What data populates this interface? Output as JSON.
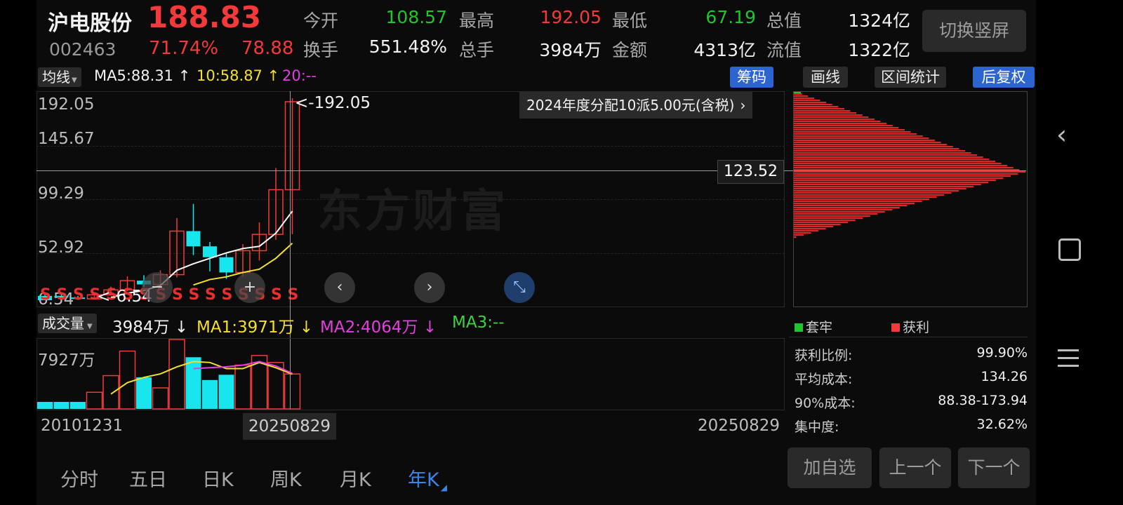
{
  "stock": {
    "name": "沪电股份",
    "price": "188.83",
    "code": "002463",
    "change_pct": "71.74%",
    "change_amt": "78.88"
  },
  "quote": [
    {
      "label": "今开",
      "value": "108.57"
    },
    {
      "label": "最高",
      "value": "192.05"
    },
    {
      "label": "最低",
      "value": "67.19"
    },
    {
      "label": "总值",
      "value": "1324亿"
    },
    {
      "label": "换手",
      "value": "551.48%"
    },
    {
      "label": "总手",
      "value": "3984万"
    },
    {
      "label": "金额",
      "value": "4313亿"
    },
    {
      "label": "流值",
      "value": "1322亿"
    }
  ],
  "switch_button": "切换竖屏",
  "ma_bar": {
    "selector": "均线",
    "ma5": "MA5:88.31",
    "ma10": "10:58.87",
    "ma20": "20:--",
    "arrow_up": "↑"
  },
  "tools": {
    "chips": "筹码",
    "draw": "画线",
    "range": "区间统计",
    "adjust": "后复权"
  },
  "price_chart": {
    "y_ticks": [
      "192.05",
      "145.67",
      "99.29",
      "52.92",
      "6.54"
    ],
    "high_marker": "<-192.05",
    "low_marker": "<-6.54",
    "crosshair_value": "123.52",
    "dividend_note": "2024年度分配10派5.00元(含税)",
    "watermark": "东方财富",
    "s_marker": "S"
  },
  "volume_bar": {
    "selector": "成交量",
    "current": "3984万",
    "ma1": "MA1:3971万",
    "ma2": "MA2:4064万",
    "ma3": "MA3:--",
    "arrow_down": "↓"
  },
  "volume_chart": {
    "y_tick": "7927万",
    "x_start": "20101231",
    "x_cursor": "20250829",
    "x_end": "20250829"
  },
  "chips_panel": {
    "legend_trapped": "套牢",
    "legend_profit": "获利",
    "stats": [
      {
        "label": "获利比例:",
        "value": "99.90%"
      },
      {
        "label": "平均成本:",
        "value": "134.26"
      },
      {
        "label": "90%成本:",
        "value": "88.38-173.94"
      },
      {
        "label": "集中度:",
        "value": "32.62%"
      }
    ]
  },
  "periods": [
    "分时",
    "五日",
    "日K",
    "周K",
    "月K",
    "年K"
  ],
  "actions": {
    "add_watch": "加自选",
    "prev": "上一个",
    "next": "下一个"
  },
  "colors": {
    "up": "#f23a3a",
    "down": "#22c42c",
    "cyan": "#17e6ee",
    "accent": "#2c65d0"
  },
  "chart_data": {
    "type": "bar",
    "candles": [
      {
        "o": 6.54,
        "c": 10.5,
        "h": 11.5,
        "l": 6.54,
        "up": false
      },
      {
        "o": 10.5,
        "c": 9.0,
        "h": 12.0,
        "l": 7.5,
        "up": false
      },
      {
        "o": 9.0,
        "c": 7.8,
        "h": 10.5,
        "l": 6.8,
        "up": false
      },
      {
        "o": 7.8,
        "c": 11.5,
        "h": 13.5,
        "l": 7.2,
        "up": true
      },
      {
        "o": 11.5,
        "c": 16.0,
        "h": 19.0,
        "l": 10.8,
        "up": true
      },
      {
        "o": 16.0,
        "c": 24.5,
        "h": 28.5,
        "l": 14.8,
        "up": true
      },
      {
        "o": 24.5,
        "c": 21.0,
        "h": 29.5,
        "l": 18.8,
        "up": false
      },
      {
        "o": 21.0,
        "c": 30.0,
        "h": 34.0,
        "l": 19.5,
        "up": true
      },
      {
        "o": 30.0,
        "c": 70.0,
        "h": 82.0,
        "l": 27.5,
        "up": true
      },
      {
        "o": 70.0,
        "c": 56.0,
        "h": 95.0,
        "l": 48.0,
        "up": false
      },
      {
        "o": 56.0,
        "c": 46.0,
        "h": 60.0,
        "l": 33.0,
        "up": false
      },
      {
        "o": 46.0,
        "c": 32.0,
        "h": 50.0,
        "l": 26.0,
        "up": false
      },
      {
        "o": 32.0,
        "c": 52.0,
        "h": 58.0,
        "l": 28.0,
        "up": true
      },
      {
        "o": 52.0,
        "c": 67.0,
        "h": 78.0,
        "l": 43.0,
        "up": true
      },
      {
        "o": 67.0,
        "c": 108.0,
        "h": 128.0,
        "l": 62.0,
        "up": true
      },
      {
        "o": 108.0,
        "c": 188.83,
        "h": 192.05,
        "l": 67.19,
        "up": true
      }
    ],
    "ma5": [
      null,
      null,
      null,
      null,
      9.0,
      13.0,
      15.5,
      20.0,
      34.0,
      40.0,
      45.0,
      50.0,
      54.0,
      56.0,
      68.0,
      88.31
    ],
    "ma10": [
      null,
      null,
      null,
      null,
      null,
      null,
      null,
      null,
      null,
      20.5,
      25.5,
      28.0,
      32.0,
      35.0,
      45.0,
      58.87
    ],
    "volumes": [
      800,
      800,
      800,
      1900,
      3800,
      6600,
      3600,
      2400,
      7927,
      5900,
      3300,
      3900,
      5000,
      6100,
      5300,
      3984
    ],
    "vol_up": [
      false,
      false,
      false,
      true,
      true,
      true,
      false,
      true,
      true,
      false,
      false,
      false,
      true,
      true,
      true,
      true
    ],
    "vol_ma1": [
      null,
      null,
      null,
      null,
      1700,
      3000,
      3600,
      4000,
      4800,
      5400,
      5300,
      4600,
      4600,
      5300,
      4700,
      3971
    ],
    "vol_ma2": [
      null,
      null,
      null,
      null,
      null,
      null,
      null,
      null,
      null,
      4600,
      4700,
      4800,
      5000,
      5400,
      4900,
      4064
    ],
    "chips_distribution": {
      "range": [
        6.54,
        192.05
      ],
      "peak_price": 123.52,
      "profit_ratio": "99.90%"
    }
  }
}
